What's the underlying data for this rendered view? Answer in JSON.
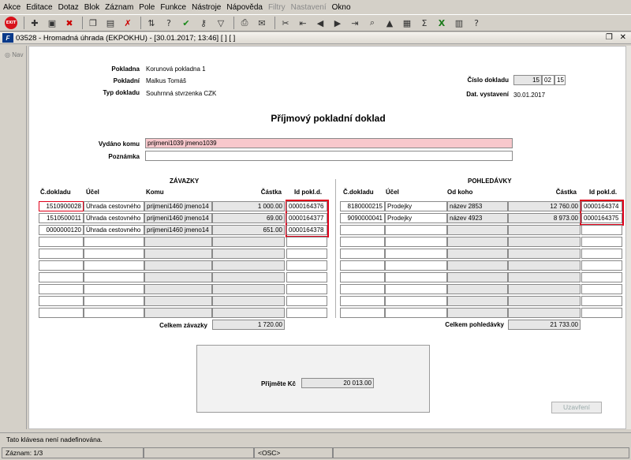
{
  "menu": [
    "Akce",
    "Editace",
    "Dotaz",
    "Blok",
    "Záznam",
    "Pole",
    "Funkce",
    "Nástroje",
    "Nápověda",
    "Filtry",
    "Nastavení",
    "Okno"
  ],
  "menu_disabled": [
    "Filtry",
    "Nastavení"
  ],
  "window": {
    "title": "03528 - Hromadná úhrada (EKPOKHU) - [30.01.2017; 13:46]  [ ] [ ]"
  },
  "nav": {
    "label": "Nav"
  },
  "header": {
    "pokladna_label": "Pokladna",
    "pokladna_value": "Korunová pokladna 1",
    "pokladni_label": "Pokladní",
    "pokladni_value": "Malkus Tomáš",
    "typ_label": "Typ dokladu",
    "typ_value": "Souhrnná stvrzenka CZK",
    "cislo_label": "Číslo dokladu",
    "cislo_parts": [
      "15",
      "02",
      "15"
    ],
    "dat_label": "Dat. vystavení",
    "dat_value": "30.01.2017"
  },
  "doc_title": "Příjmový pokladní doklad",
  "vydano_label": "Vydáno komu",
  "vydano_value": "prijmeni1039 jmeno1039",
  "poznamka_label": "Poznámka",
  "poznamka_value": "",
  "zavazky": {
    "title": "ZÁVAZKY",
    "columns": [
      "Č.dokladu",
      "Účel",
      "Komu",
      "Částka",
      "Id pokl.d."
    ],
    "rows": [
      [
        "1510900028",
        "Úhrada cestovného",
        "prijmeni1460 jmeno14",
        "1 000.00",
        "0000164376"
      ],
      [
        "1510500011",
        "Úhrada cestovného",
        "prijmeni1460 jmeno14",
        "69.00",
        "0000164377"
      ],
      [
        "0000000120",
        "Úhrada cestovného",
        "prijmeni1460 jmeno14",
        "651.00",
        "0000164378"
      ]
    ],
    "total_label": "Celkem závazky",
    "total_value": "1 720.00"
  },
  "pohledavky": {
    "title": "POHLEDÁVKY",
    "columns": [
      "Č.dokladu",
      "Účel",
      "Od koho",
      "Částka",
      "Id pokl.d."
    ],
    "rows": [
      [
        "8180000215",
        "Prodejky",
        "název 2853",
        "12 760.00",
        "0000164374"
      ],
      [
        "9090000041",
        "Prodejky",
        "název 4923",
        "8 973.00",
        "0000164375"
      ]
    ],
    "total_label": "Celkem pohledávky",
    "total_value": "21 733.00"
  },
  "prijmete_label": "Přijměte Kč",
  "prijmete_value": "20 013.00",
  "uzavreni_label": "Uzavření",
  "status": {
    "message": "Tato klávesa není nadefinována.",
    "record": "Záznam: 1/3",
    "mode": "<OSC>"
  },
  "icons": [
    "exit-icon",
    "save-icon",
    "print-icon",
    "check-icon",
    "filter-icon",
    "calculator-icon",
    "sum-icon",
    "excel-icon",
    "help-icon"
  ]
}
